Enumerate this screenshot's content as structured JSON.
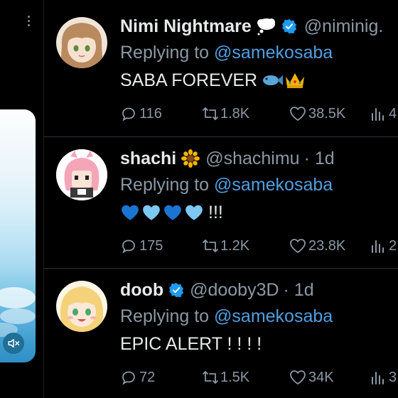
{
  "colors": {
    "background": "#000000",
    "text": "#e7e9ea",
    "secondary_text": "#8b98a5",
    "mention": "#4f9fe0",
    "verified": "#1d9bf0",
    "divider": "#2f3336"
  },
  "tweets": [
    {
      "display_name": "Nimi Nightmare",
      "name_badges": [
        "thought-balloon-icon",
        "verified-badge-icon"
      ],
      "handle": "@niminig.",
      "time": "",
      "reply_prefix": "Replying to",
      "reply_to": "@samekosaba",
      "text": "SABA FOREVER",
      "text_emoji": [
        "fish-icon",
        "crown-icon"
      ],
      "replies": "116",
      "retweets": "1.8K",
      "likes": "38.5K",
      "views": "4"
    },
    {
      "display_name": "shachi",
      "name_badges": [
        "sunflower-icon"
      ],
      "handle": "@shachimu",
      "time": "· 1d",
      "reply_prefix": "Replying to",
      "reply_to": "@samekosaba",
      "text": "!!!",
      "text_emoji": [
        "blue-heart-icon",
        "light-blue-heart-icon",
        "blue-heart-icon",
        "light-blue-heart-icon"
      ],
      "replies": "175",
      "retweets": "1.2K",
      "likes": "23.8K",
      "views": "2"
    },
    {
      "display_name": "doob",
      "name_badges": [
        "verified-badge-icon"
      ],
      "handle": "@dooby3D",
      "time": "· 1d",
      "reply_prefix": "Replying to",
      "reply_to": "@samekosaba",
      "text": "EPIC ALERT ! ! ! !",
      "text_emoji": [],
      "replies": "72",
      "retweets": "1.5K",
      "likes": "34K",
      "views": "3"
    }
  ]
}
